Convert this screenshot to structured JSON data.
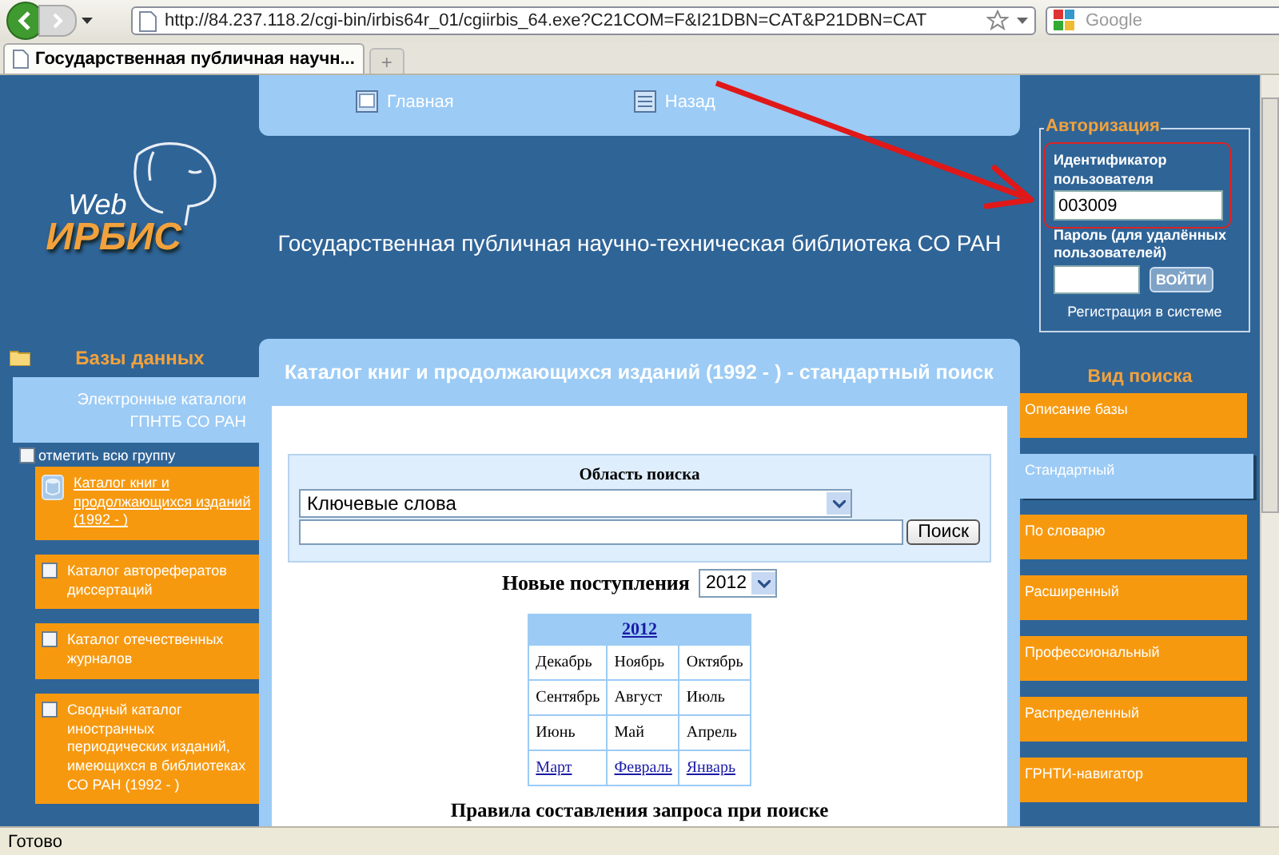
{
  "browser": {
    "url": "http://84.237.118.2/cgi-bin/irbis64r_01/cgiirbis_64.exe?C21COM=F&I21DBN=CAT&P21DBN=CAT",
    "search_placeholder": "Google",
    "new_tab": "+",
    "tabs": [
      {
        "label": "Государственная публичная научн...",
        "selected": true
      }
    ]
  },
  "nav": [
    {
      "label": "Главная",
      "kind": "window"
    },
    {
      "label": "Назад",
      "kind": "list"
    }
  ],
  "logo": {
    "line1": "Web",
    "line2": "ИРБИС"
  },
  "site_title": "Государственная публичная научно-техническая библиотека СО РАН",
  "auth": {
    "legend": "Авторизация",
    "id_label": "Идентификатор пользователя",
    "id_value": "003009",
    "password_label": "Пароль (для удалённых пользователей)",
    "login_button": "ВОЙТИ",
    "register_link": "Регистрация в системе"
  },
  "databases": {
    "title": "Базы данных",
    "group": "Электронные каталоги ГПНТБ СО РАН",
    "select_all": {
      "label": "отметить всю группу",
      "checked": false
    },
    "items": [
      {
        "label": "Каталог книг и продолжающихся изданий (1992 - )",
        "selected": true
      },
      {
        "label": "Каталог авторефератов диссертаций",
        "selected": false,
        "checked": false
      },
      {
        "label": "Каталог отечественных журналов",
        "selected": false,
        "checked": false
      },
      {
        "label": "Сводный каталог иностранных периодических изданий, имеющихся в библиотеках СО РАН (1992 - )",
        "selected": false,
        "checked": false
      }
    ]
  },
  "catalog": {
    "title": "Каталог книг и продолжающихся изданий (1992 - ) - стандартный поиск",
    "search_area_label": "Область поиска",
    "search_scope": "Ключевые слова",
    "search_button": "Поиск",
    "new_arrivals_label": "Новые поступления",
    "year": "2012",
    "calendar": {
      "year": "2012",
      "months": [
        {
          "label": "Декабрь",
          "link": false
        },
        {
          "label": "Ноябрь",
          "link": false
        },
        {
          "label": "Октябрь",
          "link": false
        },
        {
          "label": "Сентябрь",
          "link": false
        },
        {
          "label": "Август",
          "link": false
        },
        {
          "label": "Июль",
          "link": false
        },
        {
          "label": "Июнь",
          "link": false
        },
        {
          "label": "Май",
          "link": false
        },
        {
          "label": "Апрель",
          "link": false
        },
        {
          "label": "Март",
          "link": true
        },
        {
          "label": "Февраль",
          "link": true
        },
        {
          "label": "Январь",
          "link": true
        }
      ]
    },
    "rules_heading": "Правила составления запроса при поиске"
  },
  "search_types": {
    "title": "Вид поиска",
    "items": [
      {
        "label": "Описание базы",
        "selected": false
      },
      {
        "label": "Стандартный",
        "selected": true
      },
      {
        "label": "По словарю",
        "selected": false
      },
      {
        "label": "Расширенный",
        "selected": false
      },
      {
        "label": "Профессиональный",
        "selected": false
      },
      {
        "label": "Распределенный",
        "selected": false
      },
      {
        "label": "ГРНТИ-навигатор",
        "selected": false
      }
    ]
  },
  "status_bar": "Готово"
}
